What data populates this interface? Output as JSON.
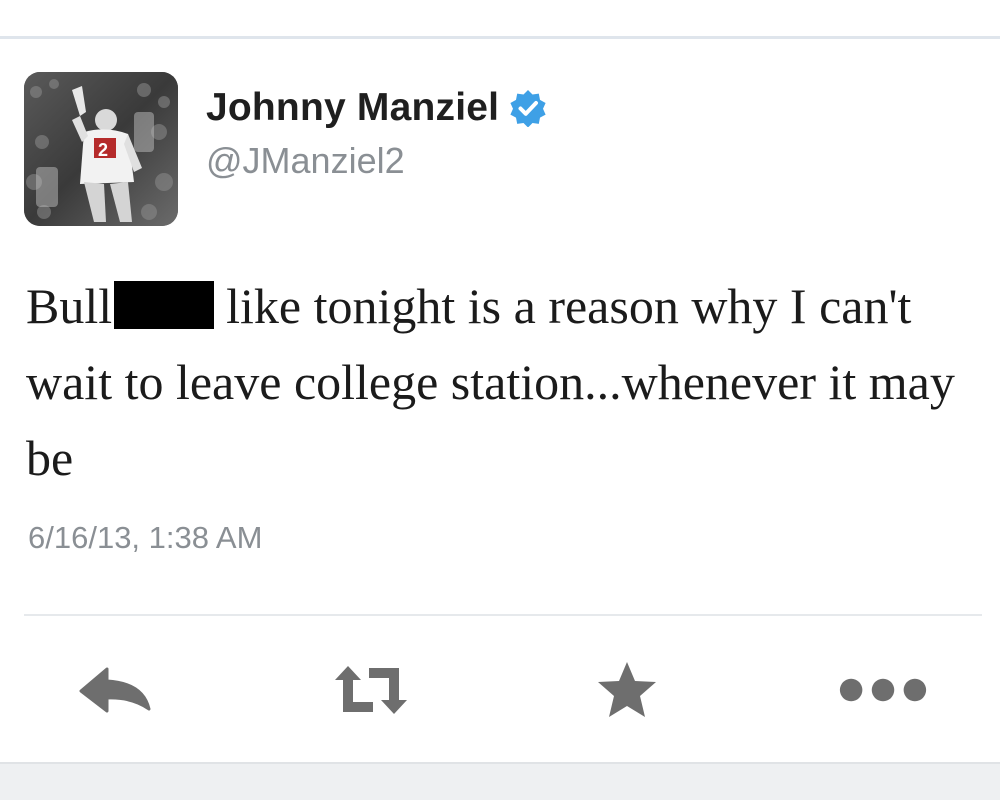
{
  "user": {
    "display_name": "Johnny Manziel",
    "handle": "@JManziel2",
    "verified": true,
    "avatar_jersey": "2"
  },
  "tweet": {
    "text_before": "Bull",
    "text_after": "like tonight is a reason why I can't wait to leave college station...whenever it may be",
    "timestamp": "6/16/13, 1:38 AM"
  },
  "actions": [
    {
      "name": "reply",
      "icon": "reply-icon"
    },
    {
      "name": "retweet",
      "icon": "retweet-icon"
    },
    {
      "name": "favorite",
      "icon": "star-icon"
    },
    {
      "name": "more",
      "icon": "more-icon"
    }
  ],
  "colors": {
    "verified_blue": "#3ea0e6",
    "icon_gray": "#6e6e6e",
    "muted_text": "#8a8f94"
  }
}
